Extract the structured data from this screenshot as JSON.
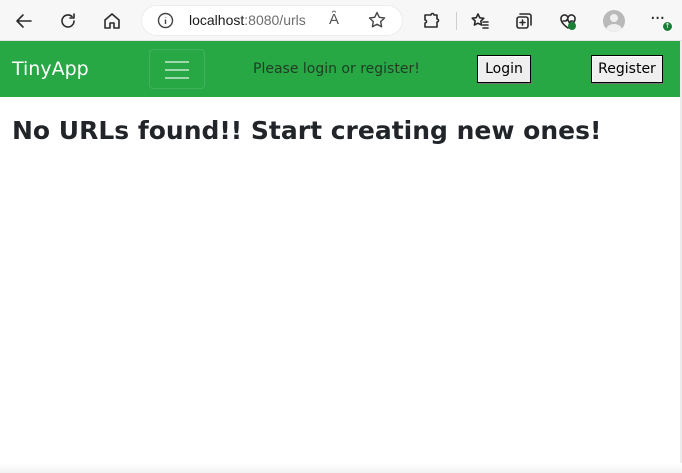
{
  "browser": {
    "url_host": "localhost",
    "url_path": ":8080/urls",
    "read_aloud_glyph": "Ȃ",
    "more_glyph": "···",
    "update_badge": "↑"
  },
  "navbar": {
    "brand": "TinyApp",
    "prompt": "Please login or register!",
    "login_label": "Login",
    "register_label": "Register",
    "accent_color": "#28a745"
  },
  "main": {
    "message": "No URLs found!! Start creating new ones!"
  }
}
